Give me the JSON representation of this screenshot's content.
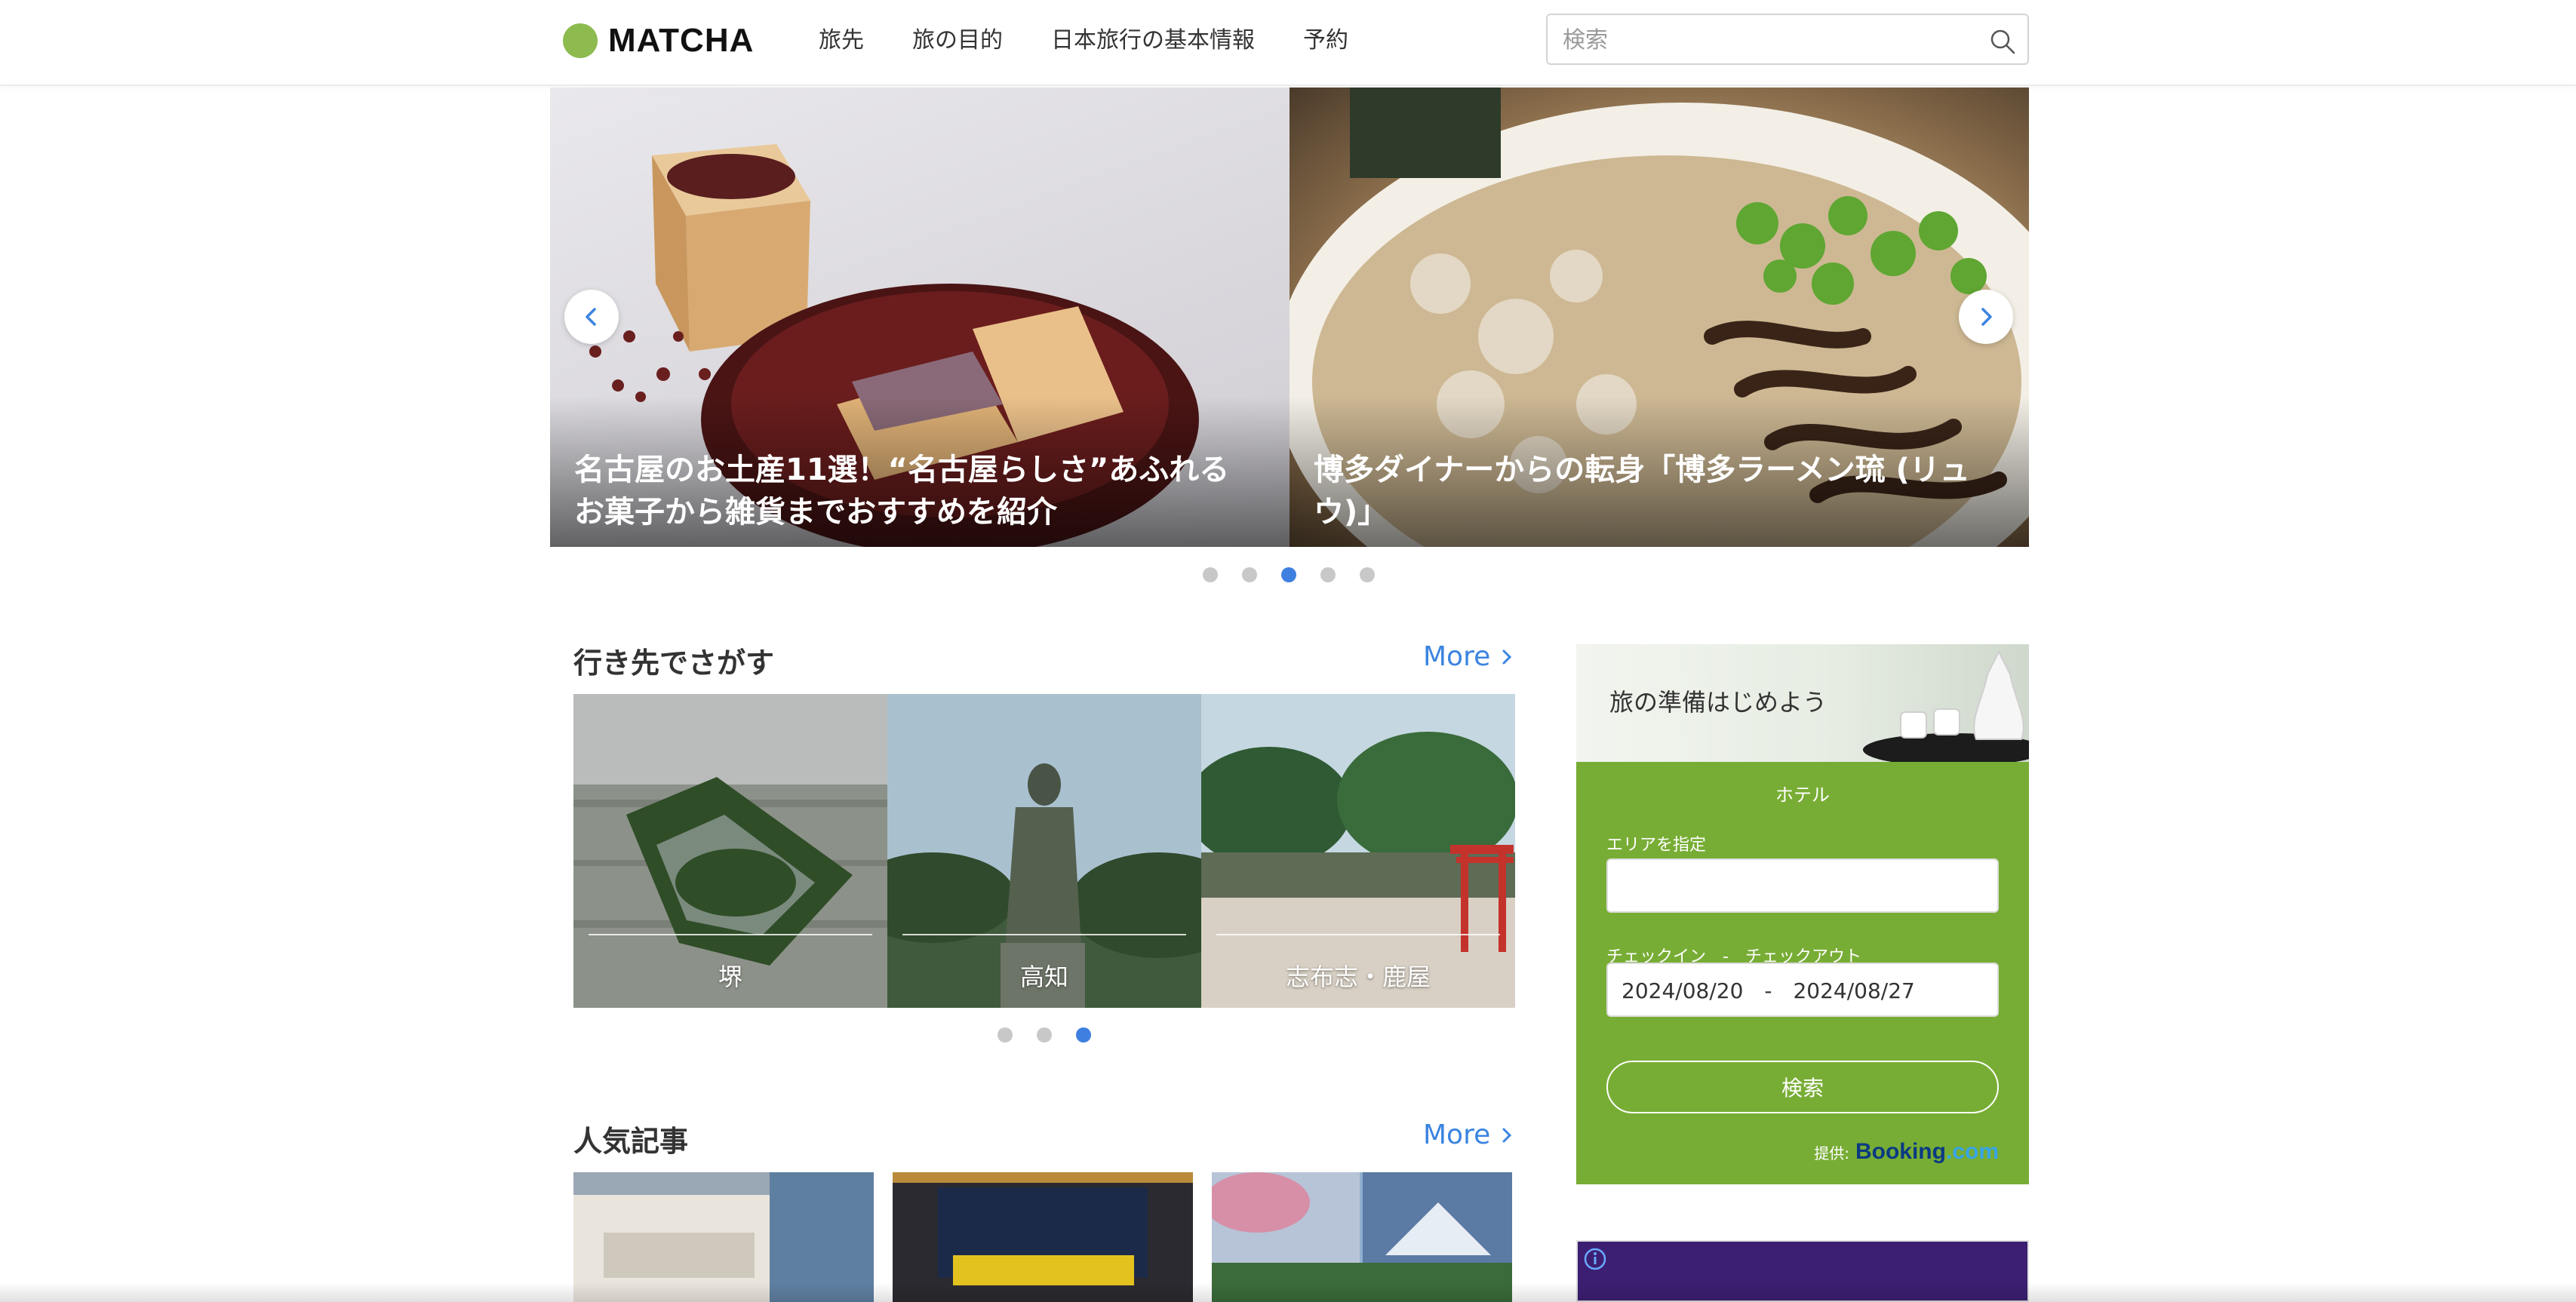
{
  "header": {
    "logo_text": "MATCHA",
    "nav": [
      "旅先",
      "旅の目的",
      "日本旅行の基本情報",
      "予約"
    ],
    "search_placeholder": "検索"
  },
  "hero": {
    "slides": [
      {
        "caption": "名古屋のお土産11選！“名古屋らしさ”あふれるお菓子から雑貨までおすすめを紹介"
      },
      {
        "caption": "博多ダイナーからの転身「博多ラーメン琉 (リュウ)」"
      }
    ],
    "dots_count": 5,
    "active_dot": 3
  },
  "destinations": {
    "title": "行き先でさがす",
    "more": "More",
    "items": [
      {
        "label": "堺"
      },
      {
        "label": "高知"
      },
      {
        "label": "志布志・鹿屋"
      }
    ],
    "dots_count": 3,
    "active_dot": 3
  },
  "popular": {
    "title": "人気記事",
    "more": "More"
  },
  "booking": {
    "banner_text": "旅の準備はじめよう",
    "tab": "ホテル",
    "area_label": "エリアを指定",
    "area_value": "",
    "dates_label": "チェックイン　-　チェックアウト",
    "dates_value": "2024/08/20　-　2024/08/27",
    "search_button": "検索",
    "credit_prefix": "提供:",
    "credit_brand": "Booking",
    "credit_brand_suffix": ".com"
  },
  "colors": {
    "accent_blue": "#3b84e0",
    "brand_green": "#8dbb4f",
    "booking_green": "#78ad35"
  }
}
